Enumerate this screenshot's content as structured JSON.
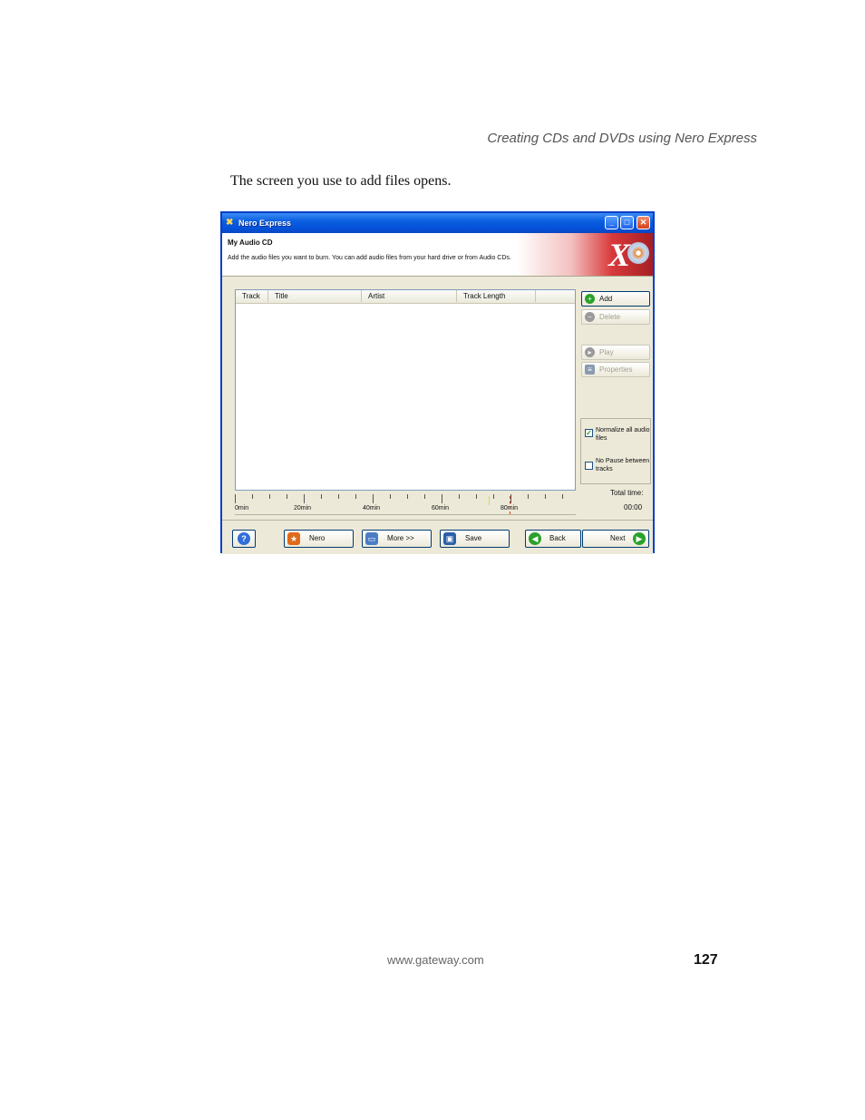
{
  "page": {
    "running_header": "Creating CDs and DVDs using Nero Express",
    "intro_text": "The screen you use to add files opens.",
    "footer_url": "www.gateway.com",
    "page_number": "127"
  },
  "window": {
    "title": "Nero Express",
    "banner_heading": "My Audio CD",
    "banner_description": "Add the audio files you want to burn. You can add audio files from your hard drive or from Audio CDs.",
    "columns": [
      "Track",
      "Title",
      "Artist",
      "Track Length"
    ],
    "side_buttons": {
      "add": "Add",
      "delete": "Delete",
      "play": "Play",
      "properties": "Properties"
    },
    "options": {
      "normalize_label": "Normalize all audio files",
      "normalize_checked": true,
      "nopause_label": "No Pause between tracks",
      "nopause_checked": false
    },
    "total_time_label": "Total time:",
    "total_time_value": "00:00",
    "ruler_labels": [
      "0min",
      "20min",
      "40min",
      "60min",
      "80min"
    ],
    "bottom_buttons": {
      "help": "?",
      "nero": "Nero",
      "more": "More >>",
      "save": "Save",
      "back": "Back",
      "next": "Next"
    }
  },
  "icons": {
    "window": "nero-app-icon",
    "add": "add-green-circle-icon",
    "delete": "delete-circle-icon",
    "play": "play-circle-icon",
    "properties": "properties-icon",
    "nero": "nero-flame-icon",
    "more": "more-window-icon",
    "save": "floppy-disk-icon",
    "back": "back-arrow-icon",
    "next": "next-arrow-icon"
  }
}
